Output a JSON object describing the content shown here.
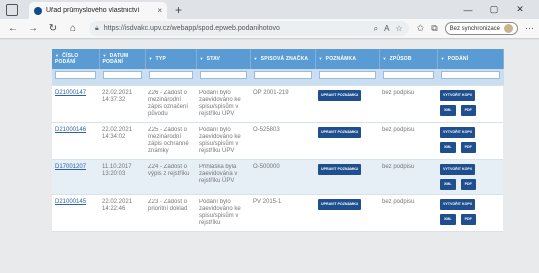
{
  "browser": {
    "tab_title": "Úřad průmyslového vlastnictví",
    "tab_close": "×",
    "new_tab": "+",
    "url": "https://isdvakc.upv.cz/webapp/spod.epweb.podanihotovo",
    "sync_label": "Bez synchronizace",
    "icons": [
      "back-icon",
      "forward-icon",
      "reload-icon",
      "home-icon",
      "lock-icon",
      "zoom-icon",
      "read-aloud-icon",
      "favorites-icon",
      "collections-icon",
      "more-icon"
    ],
    "controls": {
      "minimize": "—",
      "maximize": "▢",
      "close": "✕"
    }
  },
  "table": {
    "columns": [
      {
        "label": "ČÍSLO PODÁNÍ"
      },
      {
        "label": "DATUM PODÁNÍ"
      },
      {
        "label": "TYP"
      },
      {
        "label": "STAV"
      },
      {
        "label": "SPISOVÁ ZNAČKA"
      },
      {
        "label": "POZNÁMKA"
      },
      {
        "label": "ZPŮSOB"
      },
      {
        "label": "PODÁNÍ"
      }
    ],
    "sort_arrow": "▼",
    "btn_edit_note": "UPRAVIT POZNÁMKU",
    "btn_generate": "VYTVOŘIT KOPII",
    "btn_xml": "XML",
    "btn_pdf": "PDF",
    "rows": [
      {
        "id": "D21000147",
        "date": "22.02.2021",
        "time": "14:37:32",
        "type": "Z26 - Žádost o mezinárodní zápis označení původu",
        "status": "Podání bylo zaevidováno ke spisu/spisům v rejstříku ÚPV",
        "file": "OP 2001-219",
        "method": "bez podpisu",
        "show_xml": false
      },
      {
        "id": "D21000146",
        "date": "22.02.2021",
        "time": "14:34:02",
        "type": "Z25 - Žádost o mezinárodní zápis ochranné známky",
        "status": "Podání bylo zaevidováno ke spisu/spisům v rejstříku ÚPV",
        "file": "O-525803",
        "method": "bez podpisu",
        "show_xml": true
      },
      {
        "id": "D17001207",
        "date": "11.10.2017",
        "time": "13:20:03",
        "type": "Z24 - Žádost o výpis z rejstříku",
        "status": "Přihláška byla zaevidována v rejstříku ÚPV",
        "file": "O-500000",
        "method": "bez podpisu",
        "show_xml": true
      },
      {
        "id": "D21000145",
        "date": "22.02.2021",
        "time": "14:22:46",
        "type": "Z23 - Žádost o prioritní doklad",
        "status": "Podání bylo zaevidováno ke spisu/spisům v rejstříku",
        "file": "PV 2015-1",
        "method": "bez podpisu",
        "show_xml": true
      }
    ]
  }
}
